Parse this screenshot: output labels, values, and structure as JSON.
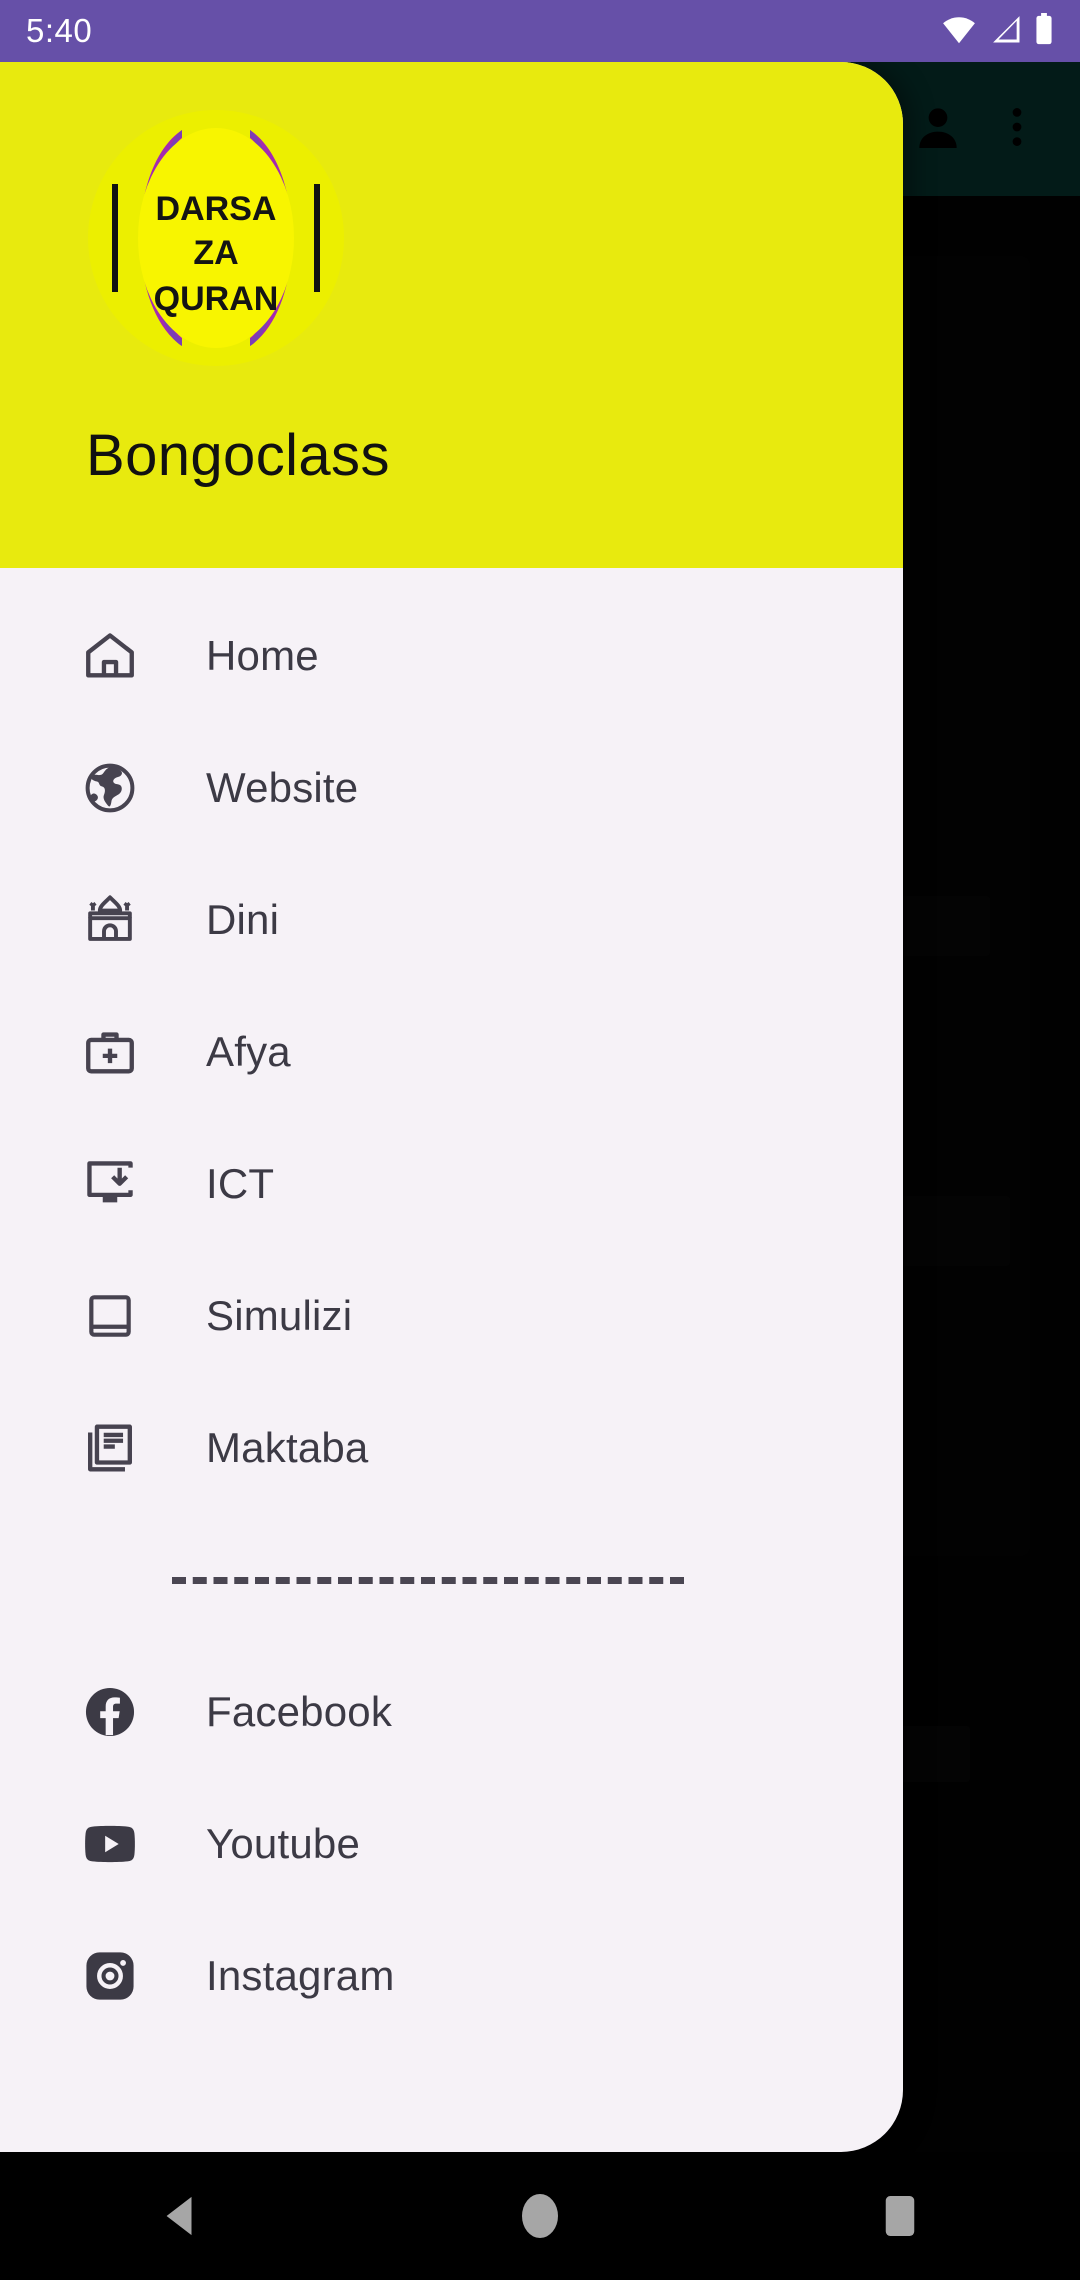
{
  "status_bar": {
    "time": "5:40",
    "icons": [
      "wifi-icon",
      "cellular-signal-icon",
      "battery-icon"
    ],
    "background": "#6650a8"
  },
  "app_bar": {
    "background": "#0b6157",
    "actions": [
      "account-icon",
      "overflow-menu-icon"
    ]
  },
  "drawer": {
    "background": "#f6f2f7",
    "header": {
      "background": "#e8ea0e",
      "brand_name": "Bongoclass",
      "logo": {
        "name": "darsa-za-quran-logo",
        "line1": "DARSA",
        "line2": "ZA",
        "line3": "QURAN",
        "circle_color": "#f8f500",
        "arc_color": "#a42ab0"
      }
    },
    "menu_items": [
      {
        "label": "Home",
        "icon": "home-icon"
      },
      {
        "label": "Website",
        "icon": "globe-icon"
      },
      {
        "label": "Dini",
        "icon": "mosque-icon"
      },
      {
        "label": "Afya",
        "icon": "medical-kit-icon"
      },
      {
        "label": "ICT",
        "icon": "monitor-download-icon"
      },
      {
        "label": "Simulizi",
        "icon": "book-icon"
      },
      {
        "label": "Maktaba",
        "icon": "article-icon"
      }
    ],
    "separator": "dashed-divider",
    "social_items": [
      {
        "label": "Facebook",
        "icon": "facebook-icon"
      },
      {
        "label": "Youtube",
        "icon": "youtube-icon"
      },
      {
        "label": "Instagram",
        "icon": "instagram-icon"
      }
    ]
  },
  "nav_bar": {
    "buttons": [
      {
        "name": "back-button",
        "icon": "back-triangle-icon"
      },
      {
        "name": "home-button",
        "icon": "home-circle-icon"
      },
      {
        "name": "recents-button",
        "icon": "recents-square-icon"
      }
    ]
  }
}
